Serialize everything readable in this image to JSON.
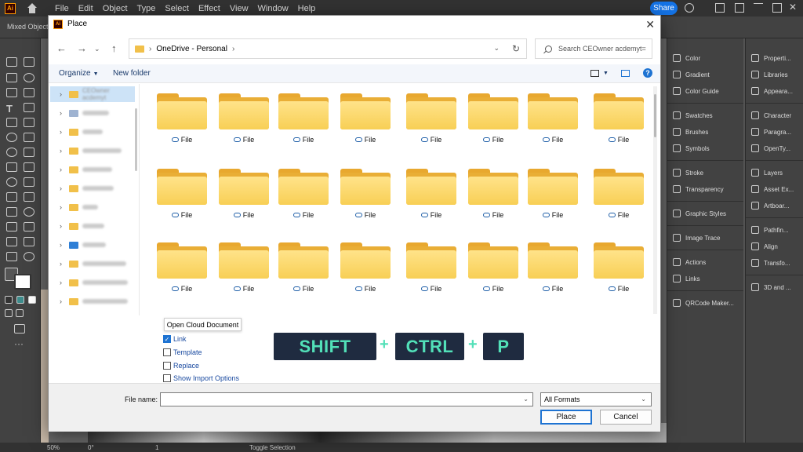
{
  "app": {
    "logo": "Ai",
    "menu": [
      "File",
      "Edit",
      "Object",
      "Type",
      "Select",
      "Effect",
      "View",
      "Window",
      "Help"
    ],
    "share_label": "Share",
    "control_label": "Mixed Objects"
  },
  "panels": {
    "col1": [
      "Color",
      "Gradient",
      "Color Guide",
      "Swatches",
      "Brushes",
      "Symbols",
      "Stroke",
      "Transparency",
      "Graphic Styles",
      "Image Trace",
      "Actions",
      "Links",
      "QRCode Maker..."
    ],
    "col2": [
      "Properti...",
      "Libraries",
      "Appeara...",
      "Character",
      "Paragra...",
      "OpenTy...",
      "Layers",
      "Asset Ex...",
      "Artboar...",
      "Pathfin...",
      "Align",
      "Transfo...",
      "3D and ..."
    ]
  },
  "status": {
    "zoom": "50%",
    "rotation": "0°",
    "artboard": "1",
    "tool": "Toggle Selection"
  },
  "dialog": {
    "title": "Place",
    "close_glyph": "✕",
    "address": {
      "path": [
        "OneDrive - Personal"
      ]
    },
    "search_placeholder": "Search CEOwner acdemyt=",
    "organize_label": "Organize",
    "new_folder_label": "New folder",
    "help_glyph": "?",
    "tree_first_label": "CEOwner acdemyt",
    "file_label": "File",
    "open_cloud_label": "Open Cloud Document",
    "options": [
      {
        "label": "Link",
        "checked": true
      },
      {
        "label": "Template",
        "checked": false
      },
      {
        "label": "Replace",
        "checked": false
      },
      {
        "label": "Show Import Options",
        "checked": false
      }
    ],
    "filename_label": "File name:",
    "filename_value": "",
    "format_value": "All Formats",
    "place_button": "Place",
    "cancel_button": "Cancel"
  },
  "shortcut": {
    "keys": [
      "SHIFT",
      "CTRL",
      "P"
    ],
    "separator": "+"
  },
  "colors": {
    "shortcut_bg": "#1f2b40",
    "shortcut_text": "#52e0b8",
    "accent": "#1e73d2",
    "folder": "#f8cf55"
  }
}
